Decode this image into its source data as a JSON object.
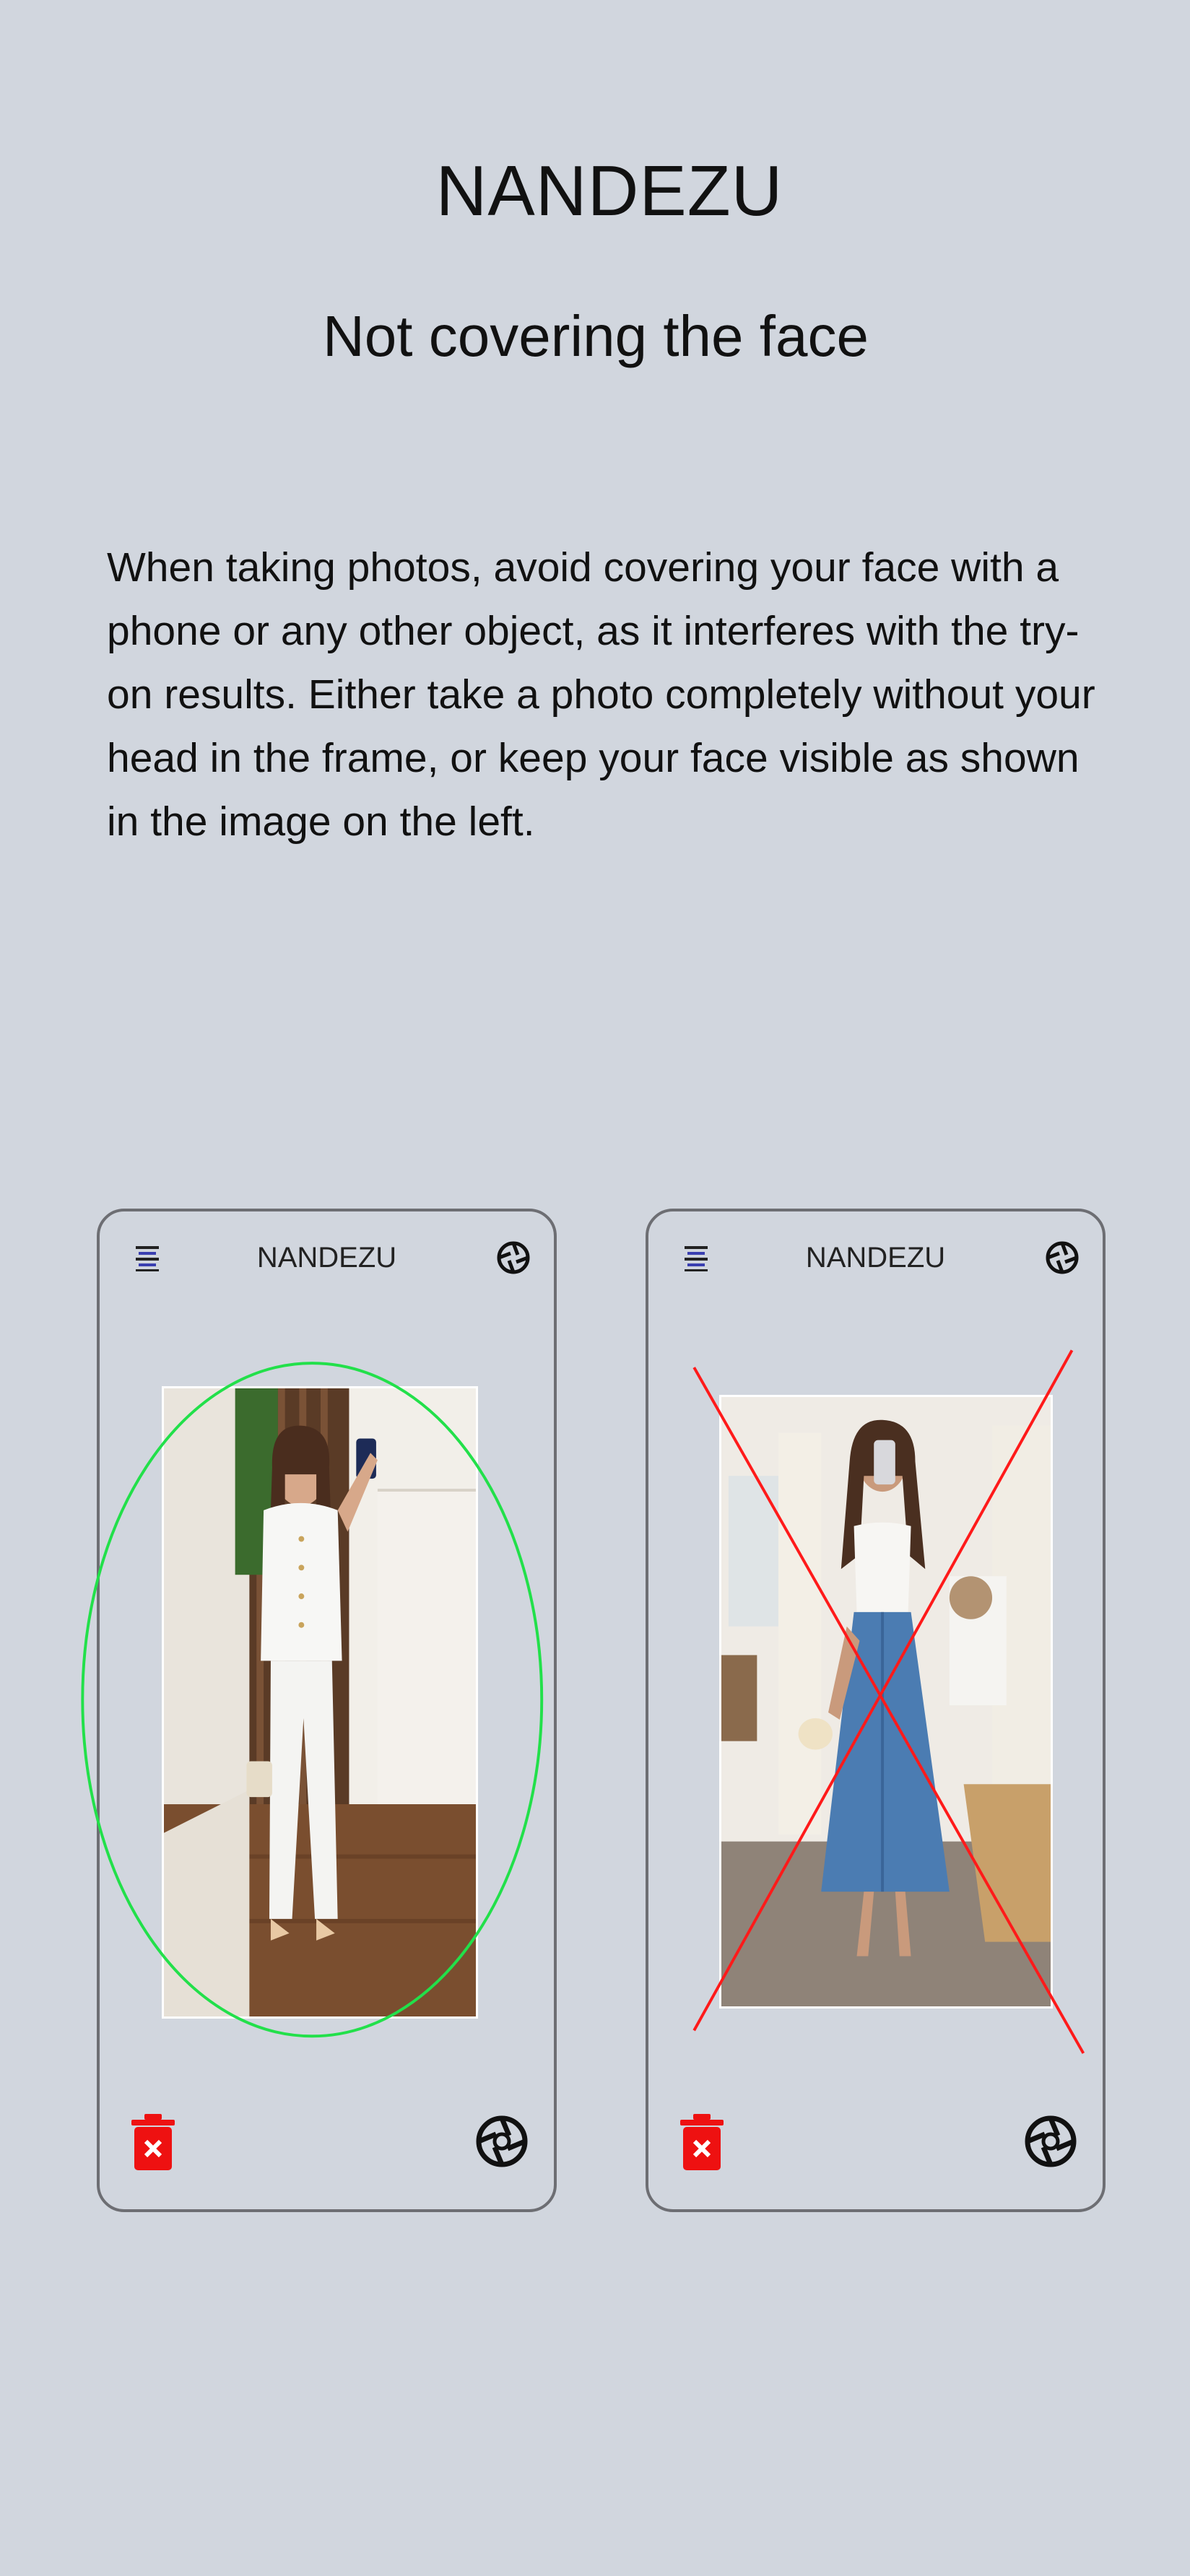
{
  "app": {
    "title": "NANDEZU"
  },
  "heading": "Not covering the face",
  "instruction": "When taking photos, avoid covering your face with a phone or any other object, as it interferes with the try-on results. Either take a photo completely without your head in the frame, or keep your face visible as shown in the image on the left.",
  "examples": [
    {
      "app_title": "NANDEZU",
      "status": "correct",
      "marker_color": "#22e04a",
      "photo": "person-in-white-outfit-face-visible"
    },
    {
      "app_title": "NANDEZU",
      "status": "incorrect",
      "marker_color": "#ff1a1a",
      "photo": "person-in-blue-skirt-face-covered-by-phone"
    }
  ],
  "icons": {
    "menu": "menu-icon",
    "settings": "aperture-icon",
    "delete": "trash-icon",
    "capture": "camera-aperture-icon",
    "accent_menu": "#3a3fb0",
    "delete_color": "#ee1111"
  }
}
